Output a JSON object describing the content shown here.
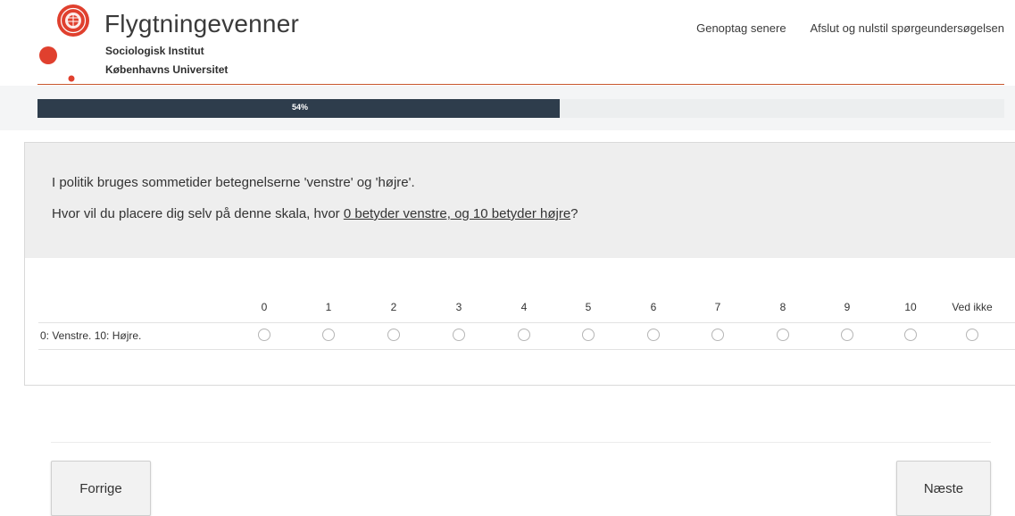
{
  "header": {
    "title": "Flygtningevenner",
    "subtitle_line1": "Sociologisk Institut",
    "subtitle_line2": "Københavns Universitet",
    "links": {
      "resume_later": "Genoptag senere",
      "exit_reset": "Afslut og nulstil spørgeundersøgelsen"
    },
    "accent_color": "#c8572e",
    "logo_color": "#e0402e"
  },
  "progress": {
    "value": 0.54,
    "label": "54%",
    "bar_color": "#2e3d4c"
  },
  "question": {
    "line1": "I politik bruges sommetider betegnelserne 'venstre' og 'højre'.",
    "line2_prefix": "Hvor vil du placere dig selv på denne skala, hvor ",
    "line2_underlined": "0 betyder venstre, og 10 betyder højre",
    "line2_suffix": "?"
  },
  "scale": {
    "columns": [
      "0",
      "1",
      "2",
      "3",
      "4",
      "5",
      "6",
      "7",
      "8",
      "9",
      "10",
      "Ved ikke"
    ],
    "row_label": "0: Venstre. 10: Højre.",
    "selected": null
  },
  "navigation": {
    "previous_label": "Forrige",
    "next_label": "Næste"
  }
}
